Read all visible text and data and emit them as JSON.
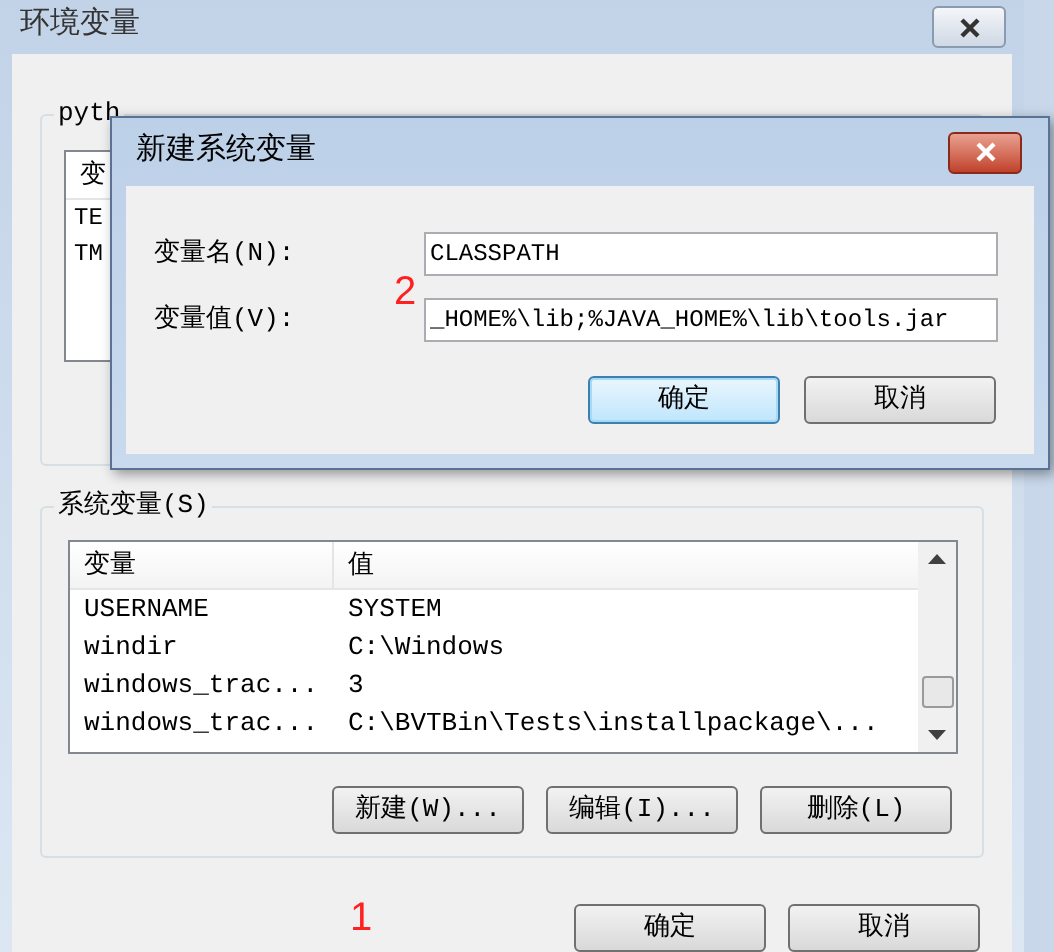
{
  "window": {
    "title": "环境变量"
  },
  "user_variables": {
    "label": "pyth",
    "columns": [
      "变"
    ],
    "rows": [
      "TE",
      "TM"
    ]
  },
  "system_variables": {
    "label": "系统变量(S)",
    "columns": [
      "变量",
      "值"
    ],
    "rows": [
      {
        "name": "USERNAME",
        "value": "SYSTEM"
      },
      {
        "name": "windir",
        "value": "C:\\Windows"
      },
      {
        "name": "windows_trac...",
        "value": "3"
      },
      {
        "name": "windows_trac...",
        "value": "C:\\BVTBin\\Tests\\installpackage\\..."
      }
    ],
    "buttons": [
      "新建(W)...",
      "编辑(I)...",
      "删除(L)"
    ]
  },
  "buttons": [
    "确定",
    "取消"
  ],
  "marker": "1",
  "dialog": {
    "title": "新建系统变量",
    "marker": "2",
    "fields": [
      {
        "label": "变量名(N):",
        "value": "CLASSPATH"
      },
      {
        "label": "变量值(V):",
        "value": "_HOME%\\lib;%JAVA_HOME%\\lib\\tools.jar"
      }
    ],
    "buttons": [
      {
        "label": "确定",
        "default": true
      },
      {
        "label": "取消",
        "default": false
      }
    ]
  }
}
